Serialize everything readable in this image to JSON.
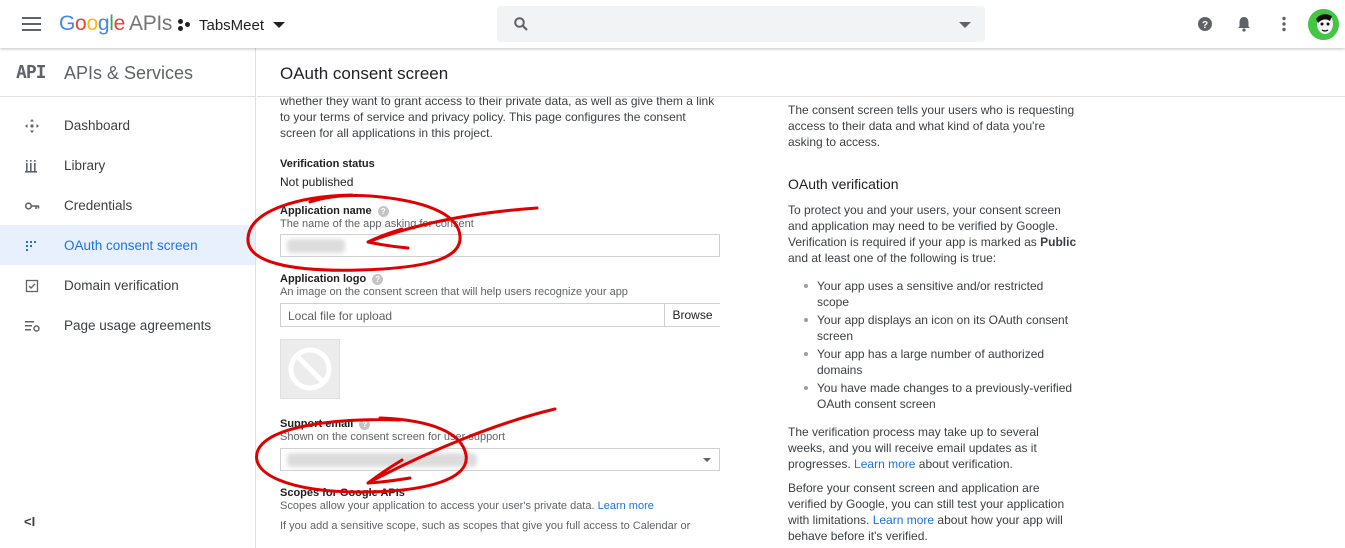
{
  "header": {
    "logo_parts": [
      "G",
      "o",
      "o",
      "g",
      "l",
      "e"
    ],
    "logo_suffix": "APIs",
    "project_name": "TabsMeet",
    "search_placeholder": ""
  },
  "sidebar": {
    "badge": "API",
    "title": "APIs & Services",
    "items": [
      {
        "label": "Dashboard",
        "icon": "dashboard-icon"
      },
      {
        "label": "Library",
        "icon": "library-icon"
      },
      {
        "label": "Credentials",
        "icon": "key-icon"
      },
      {
        "label": "OAuth consent screen",
        "icon": "consent-icon",
        "active": true
      },
      {
        "label": "Domain verification",
        "icon": "check-box-icon"
      },
      {
        "label": "Page usage agreements",
        "icon": "settings-list-icon"
      }
    ],
    "collapse_label": "<I"
  },
  "main": {
    "title": "OAuth consent screen",
    "intro": "whether they want to grant access to their private data, as well as give them a link to your terms of service and privacy policy. This page configures the consent screen for all applications in this project.",
    "verification_status_label": "Verification status",
    "verification_status_value": "Not published",
    "app_name_label": "Application name",
    "app_name_help": "The name of the app asking for consent",
    "app_logo_label": "Application logo",
    "app_logo_help": "An image on the consent screen that will help users recognize your app",
    "file_placeholder": "Local file for upload",
    "browse_label": "Browse",
    "support_email_label": "Support email",
    "support_email_help": "Shown on the consent screen for user support",
    "scopes_label": "Scopes for Google APIs",
    "scopes_help": "Scopes allow your application to access your user's private data.",
    "scopes_learn_more": "Learn more",
    "scopes_sensitive": "If you add a sensitive scope, such as scopes that give you full access to Calendar or"
  },
  "info": {
    "intro": "The consent screen tells your users who is requesting access to their data and what kind of data you're asking to access.",
    "heading": "OAuth verification",
    "para1_a": "To protect you and your users, your consent screen and application may need to be verified by Google. Verification is required if your app is marked as",
    "para1_bold": "Public",
    "para1_b": "and at least one of the following is true:",
    "bullets": [
      "Your app uses a sensitive and/or restricted scope",
      "Your app displays an icon on its OAuth consent screen",
      "Your app has a large number of authorized domains",
      "You have made changes to a previously-verified OAuth consent screen"
    ],
    "para2_a": "The verification process may take up to several weeks, and you will receive email updates as it progresses.",
    "para2_link": "Learn more",
    "para2_b": "about verification.",
    "para3_a": "Before your consent screen and application are verified by Google, you can still test your application with limitations.",
    "para3_link": "Learn more",
    "para3_b": "about how your app will behave before it's verified."
  },
  "colors": {
    "accent": "#1a73e8",
    "active_bg": "#e8f0fe",
    "annotation": "#e00000"
  }
}
